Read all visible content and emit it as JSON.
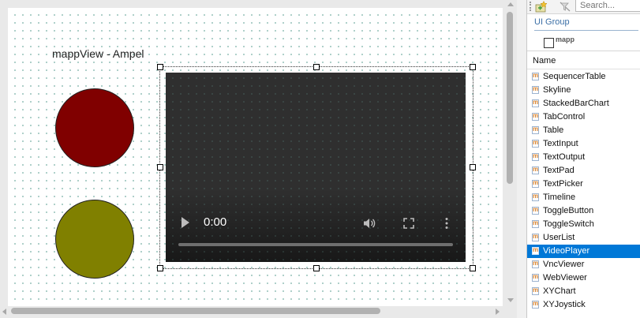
{
  "designer": {
    "page_title": "mappView - Ampel",
    "lamps": [
      {
        "name": "red-lamp",
        "color": "#800000"
      },
      {
        "name": "yellow-lamp",
        "color": "#808000"
      }
    ],
    "video_player": {
      "time": "0:00",
      "controls": [
        "play-icon",
        "volume-icon",
        "fullscreen-icon",
        "more-options-icon"
      ]
    }
  },
  "toolbox": {
    "search_placeholder": "Search...",
    "group_title": "UI Group",
    "group_item": "mapp",
    "column_header": "Name",
    "items": [
      {
        "label": "SequencerTable"
      },
      {
        "label": "Skyline"
      },
      {
        "label": "StackedBarChart"
      },
      {
        "label": "TabControl"
      },
      {
        "label": "Table"
      },
      {
        "label": "TextInput"
      },
      {
        "label": "TextOutput"
      },
      {
        "label": "TextPad"
      },
      {
        "label": "TextPicker"
      },
      {
        "label": "Timeline"
      },
      {
        "label": "ToggleButton"
      },
      {
        "label": "ToggleSwitch"
      },
      {
        "label": "UserList"
      },
      {
        "label": "VideoPlayer",
        "selected": true
      },
      {
        "label": "VncViewer"
      },
      {
        "label": "WebViewer"
      },
      {
        "label": "XYChart"
      },
      {
        "label": "XYJoystick"
      }
    ],
    "selection_color": "#0078d7"
  }
}
